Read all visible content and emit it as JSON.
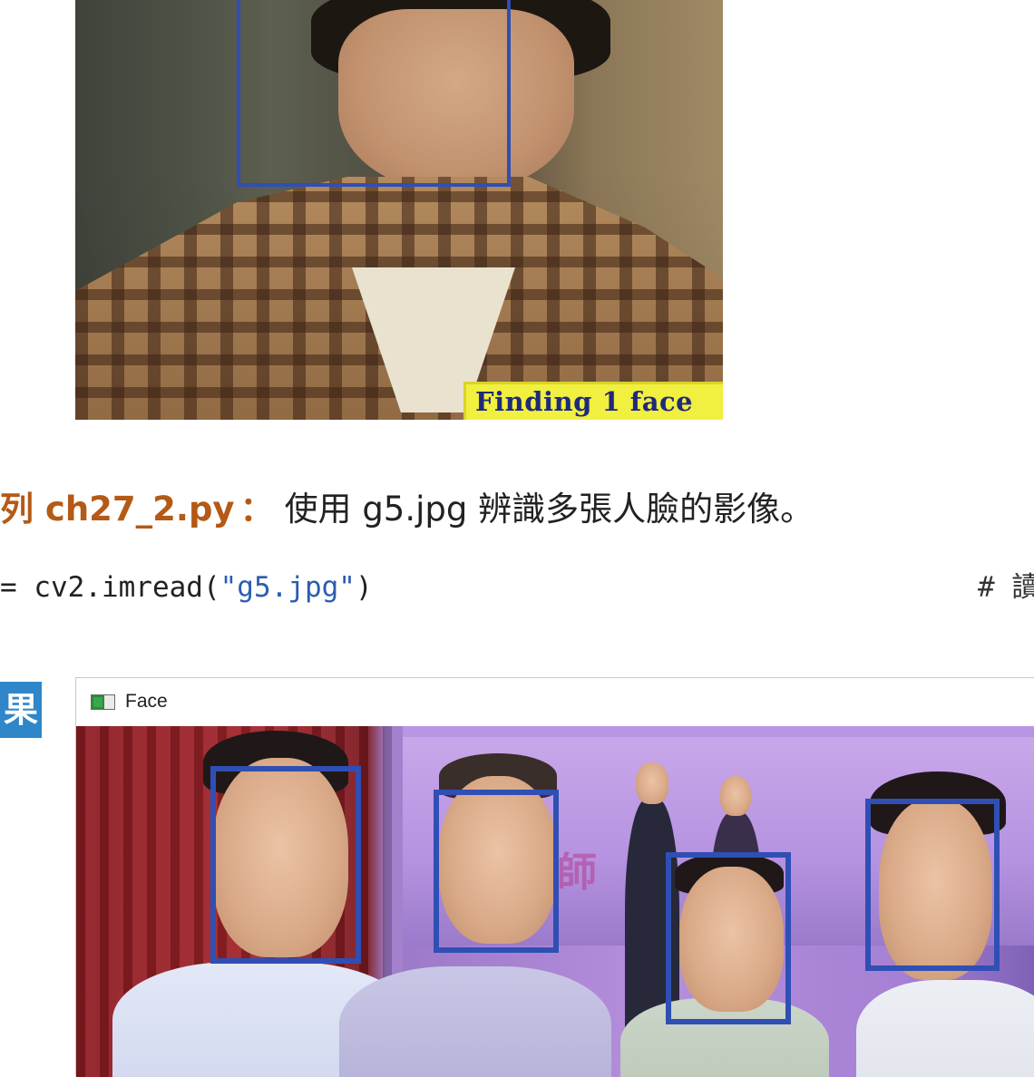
{
  "photo1": {
    "caption": "Finding 1 face",
    "faces_detected": 1
  },
  "example": {
    "label": "列 ch27_2.py",
    "colon": "：",
    "description": "使用 g5.jpg 辨識多張人臉的影像。"
  },
  "code": {
    "prefix": "= cv2.imread(",
    "string": "\"g5.jpg\"",
    "suffix": ")",
    "comment": "# 讀"
  },
  "result_badge": "果",
  "window": {
    "title": "Face",
    "icon": "opencv-window-icon",
    "faces_detected": 4
  },
  "colors": {
    "detection_box": "#2f4fb4",
    "caption_bg": "#f1ef3f",
    "caption_text": "#1f2a7a",
    "example_label": "#b45a16",
    "code_string": "#2a5db0",
    "badge_bg": "#2f86c9"
  }
}
